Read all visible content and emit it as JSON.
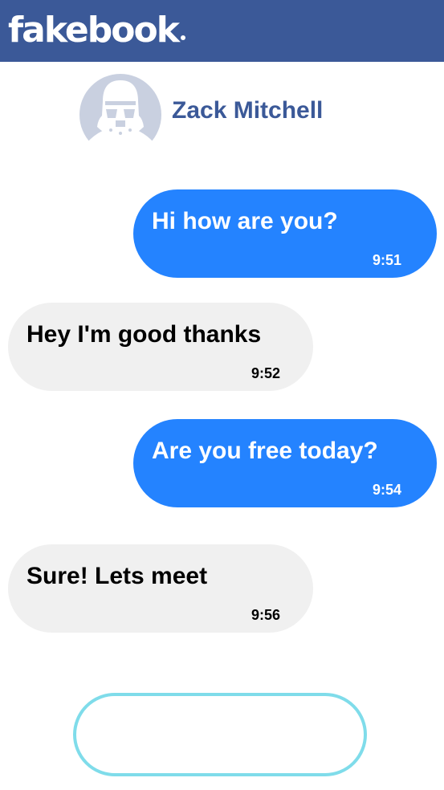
{
  "app": {
    "logo_text": "fakebook"
  },
  "contact": {
    "name": "Zack Mitchell",
    "avatar_icon": "stormtrooper-avatar-icon"
  },
  "messages": [
    {
      "direction": "sent",
      "text": "Hi how are you?",
      "time": "9:51"
    },
    {
      "direction": "received",
      "text": "Hey I'm good thanks",
      "time": "9:52"
    },
    {
      "direction": "sent",
      "text": "Are you free today?",
      "time": "9:54"
    },
    {
      "direction": "received",
      "text": "Sure! Lets meet",
      "time": "9:56"
    }
  ],
  "composer": {
    "value": "",
    "placeholder": ""
  },
  "colors": {
    "header": "#3b5998",
    "sent_bubble": "#2483ff",
    "received_bubble": "#f0f0f0",
    "composer_border": "#7fdcea",
    "name_text": "#3b5998"
  }
}
